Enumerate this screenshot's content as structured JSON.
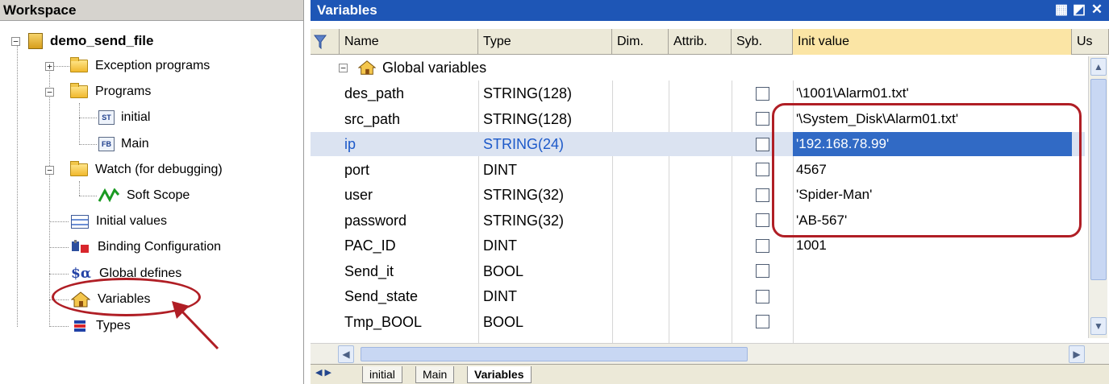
{
  "workspace": {
    "title": "Workspace",
    "project": "demo_send_file",
    "items": [
      {
        "label": "Exception programs"
      },
      {
        "label": "Programs"
      },
      {
        "label": "initial"
      },
      {
        "label": "Main"
      },
      {
        "label": "Watch (for debugging)"
      },
      {
        "label": "Soft Scope"
      },
      {
        "label": "Initial values"
      },
      {
        "label": "Binding Configuration"
      },
      {
        "label": "Global defines"
      },
      {
        "label": "Variables"
      },
      {
        "label": "Types"
      }
    ]
  },
  "editor": {
    "title": "Variables",
    "columns": [
      "Name",
      "Type",
      "Dim.",
      "Attrib.",
      "Syb.",
      "Init value",
      "Us"
    ],
    "group_label": "Global variables",
    "rows": [
      {
        "name": "des_path",
        "type": "STRING(128)",
        "init": "'\\1001\\Alarm01.txt'"
      },
      {
        "name": "src_path",
        "type": "STRING(128)",
        "init": "'\\System_Disk\\Alarm01.txt'"
      },
      {
        "name": "ip",
        "type": "STRING(24)",
        "init": "'192.168.78.99'"
      },
      {
        "name": "port",
        "type": "DINT",
        "init": "4567"
      },
      {
        "name": "user",
        "type": "STRING(32)",
        "init": "'Spider-Man'"
      },
      {
        "name": "password",
        "type": "STRING(32)",
        "init": "'AB-567'"
      },
      {
        "name": "PAC_ID",
        "type": "DINT",
        "init": "1001"
      },
      {
        "name": "Send_it",
        "type": "BOOL",
        "init": ""
      },
      {
        "name": "Send_state",
        "type": "DINT",
        "init": ""
      },
      {
        "name": "Tmp_BOOL",
        "type": "BOOL",
        "init": ""
      }
    ],
    "tabs": [
      "initial",
      "Main",
      "Variables"
    ],
    "selected_row": "ip"
  },
  "colors": {
    "title_bar": "#1e56b6",
    "selection": "#316ac5",
    "annotation": "#b01e25"
  }
}
